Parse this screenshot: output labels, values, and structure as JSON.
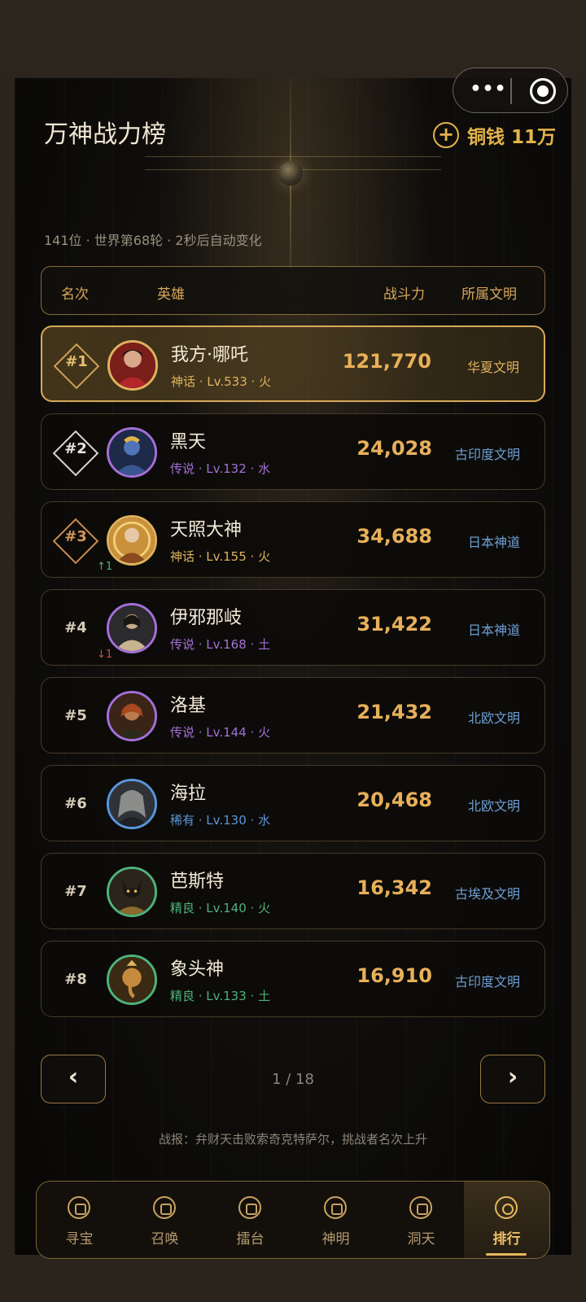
{
  "header": {
    "title": "万神战力榜",
    "coin_label": "铜钱",
    "coin_value": "11万",
    "add_icon": "plus-icon",
    "meta": "141位 · 世界第68轮 · 2秒后自动变化"
  },
  "capsule": {
    "more": "•••",
    "record_icon": "target-icon"
  },
  "table": {
    "headers": {
      "rank": "名次",
      "hero": "英雄",
      "power": "战斗力",
      "civ": "所属文明"
    }
  },
  "rows": [
    {
      "rank": "#1",
      "name": "我方·哪吒",
      "sub": "神话 · Lv.533 · 火",
      "power": "121,770",
      "civ": "华夏文明",
      "delta": ""
    },
    {
      "rank": "#2",
      "name": "黑天",
      "sub": "传说 · Lv.132 · 水",
      "power": "24,028",
      "civ": "古印度文明",
      "delta": ""
    },
    {
      "rank": "#3",
      "name": "天照大神",
      "sub": "神话 · Lv.155 · 火",
      "power": "34,688",
      "civ": "日本神道",
      "delta": "↑1"
    },
    {
      "rank": "#4",
      "name": "伊邪那岐",
      "sub": "传说 · Lv.168 · 土",
      "power": "31,422",
      "civ": "日本神道",
      "delta": "↓1"
    },
    {
      "rank": "#5",
      "name": "洛基",
      "sub": "传说 · Lv.144 · 火",
      "power": "21,432",
      "civ": "北欧文明",
      "delta": ""
    },
    {
      "rank": "#6",
      "name": "海拉",
      "sub": "稀有 · Lv.130 · 水",
      "power": "20,468",
      "civ": "北欧文明",
      "delta": ""
    },
    {
      "rank": "#7",
      "name": "芭斯特",
      "sub": "精良 · Lv.140 · 火",
      "power": "16,342",
      "civ": "古埃及文明",
      "delta": ""
    },
    {
      "rank": "#8",
      "name": "象头神",
      "sub": "精良 · Lv.133 · 土",
      "power": "16,910",
      "civ": "古印度文明",
      "delta": ""
    }
  ],
  "pagination": {
    "prev": "‹",
    "next": "›",
    "text": "1 / 18"
  },
  "news": "战报：弁财天击败索奇克特萨尔，挑战者名次上升",
  "nav": [
    {
      "label": "寻宝",
      "icon": "treasure-icon"
    },
    {
      "label": "召唤",
      "icon": "summon-icon"
    },
    {
      "label": "擂台",
      "icon": "arena-icon"
    },
    {
      "label": "神明",
      "icon": "deity-icon"
    },
    {
      "label": "洞天",
      "icon": "realm-icon"
    },
    {
      "label": "排行",
      "icon": "ranking-icon"
    }
  ],
  "colors": {
    "accent": "#d9a85a",
    "myth": "#e0b25e",
    "legend": "#a56fd8",
    "rare": "#5b95d8",
    "fine": "#4fb27a",
    "civ": "#6e9ed4"
  }
}
